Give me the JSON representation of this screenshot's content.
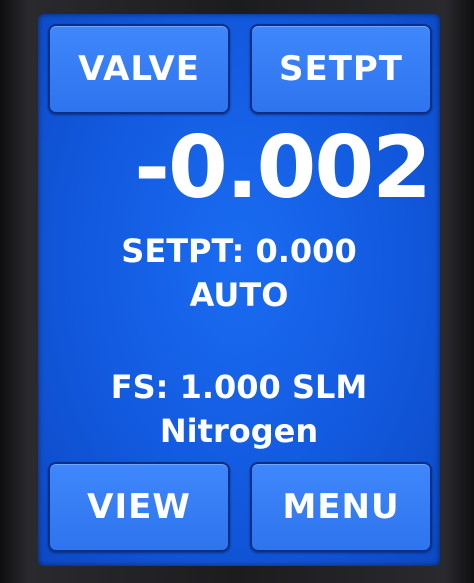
{
  "buttons": {
    "valve": "VALVE",
    "setpt": "SETPT",
    "view": "VIEW",
    "menu": "MENU"
  },
  "display": {
    "flow_reading": "-0.002",
    "setpoint_text": "SETPT: 0.000",
    "mode": "AUTO",
    "full_scale_text": "FS: 1.000 SLM",
    "gas": "Nitrogen"
  },
  "colors": {
    "screen_background": "#1259de",
    "button_fill": "#3a80f8",
    "button_border": "#0b2f88",
    "text": "#ffffff"
  }
}
